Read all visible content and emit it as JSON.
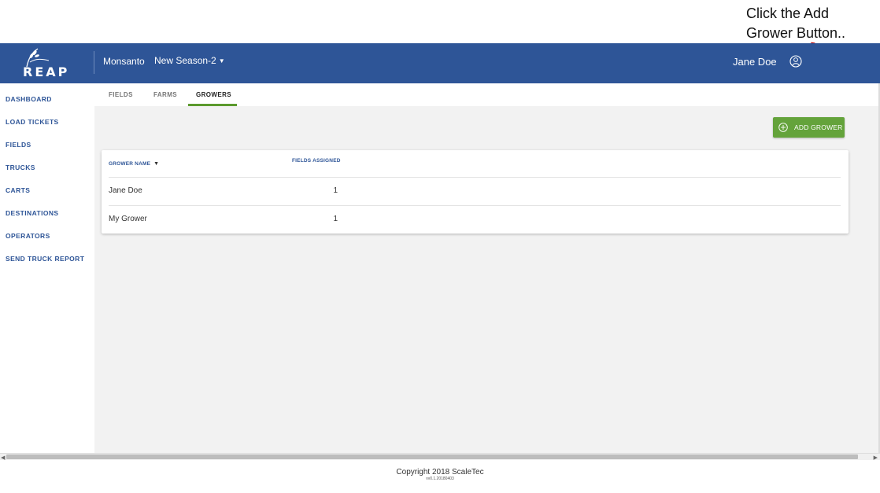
{
  "annotation": {
    "line1": "Click the Add",
    "line2": "Grower Button.."
  },
  "header": {
    "logo_text": "REAP",
    "company": "Monsanto",
    "season": "New Season-2",
    "user_name": "Jane Doe",
    "brand_color": "#2e5597"
  },
  "sidebar": {
    "items": [
      {
        "label": "DASHBOARD"
      },
      {
        "label": "LOAD TICKETS"
      },
      {
        "label": "FIELDS"
      },
      {
        "label": "TRUCKS"
      },
      {
        "label": "CARTS"
      },
      {
        "label": "DESTINATIONS"
      },
      {
        "label": "OPERATORS"
      },
      {
        "label": "SEND TRUCK REPORT"
      }
    ]
  },
  "tabs": [
    {
      "label": "FIELDS"
    },
    {
      "label": "FARMS"
    },
    {
      "label": "GROWERS",
      "active": true
    }
  ],
  "actions": {
    "add_grower": "ADD GROWER",
    "accent_color": "#64a33b"
  },
  "table": {
    "columns": [
      {
        "label": "GROWER NAME"
      },
      {
        "label": "FIELDS ASSIGNED"
      }
    ],
    "rows": [
      {
        "name": "Jane Doe",
        "fields": "1"
      },
      {
        "name": "My Grower",
        "fields": "1"
      }
    ]
  },
  "footer": {
    "copyright": "Copyright 2018 ScaleTec",
    "version": "vv0.1.20180403"
  }
}
